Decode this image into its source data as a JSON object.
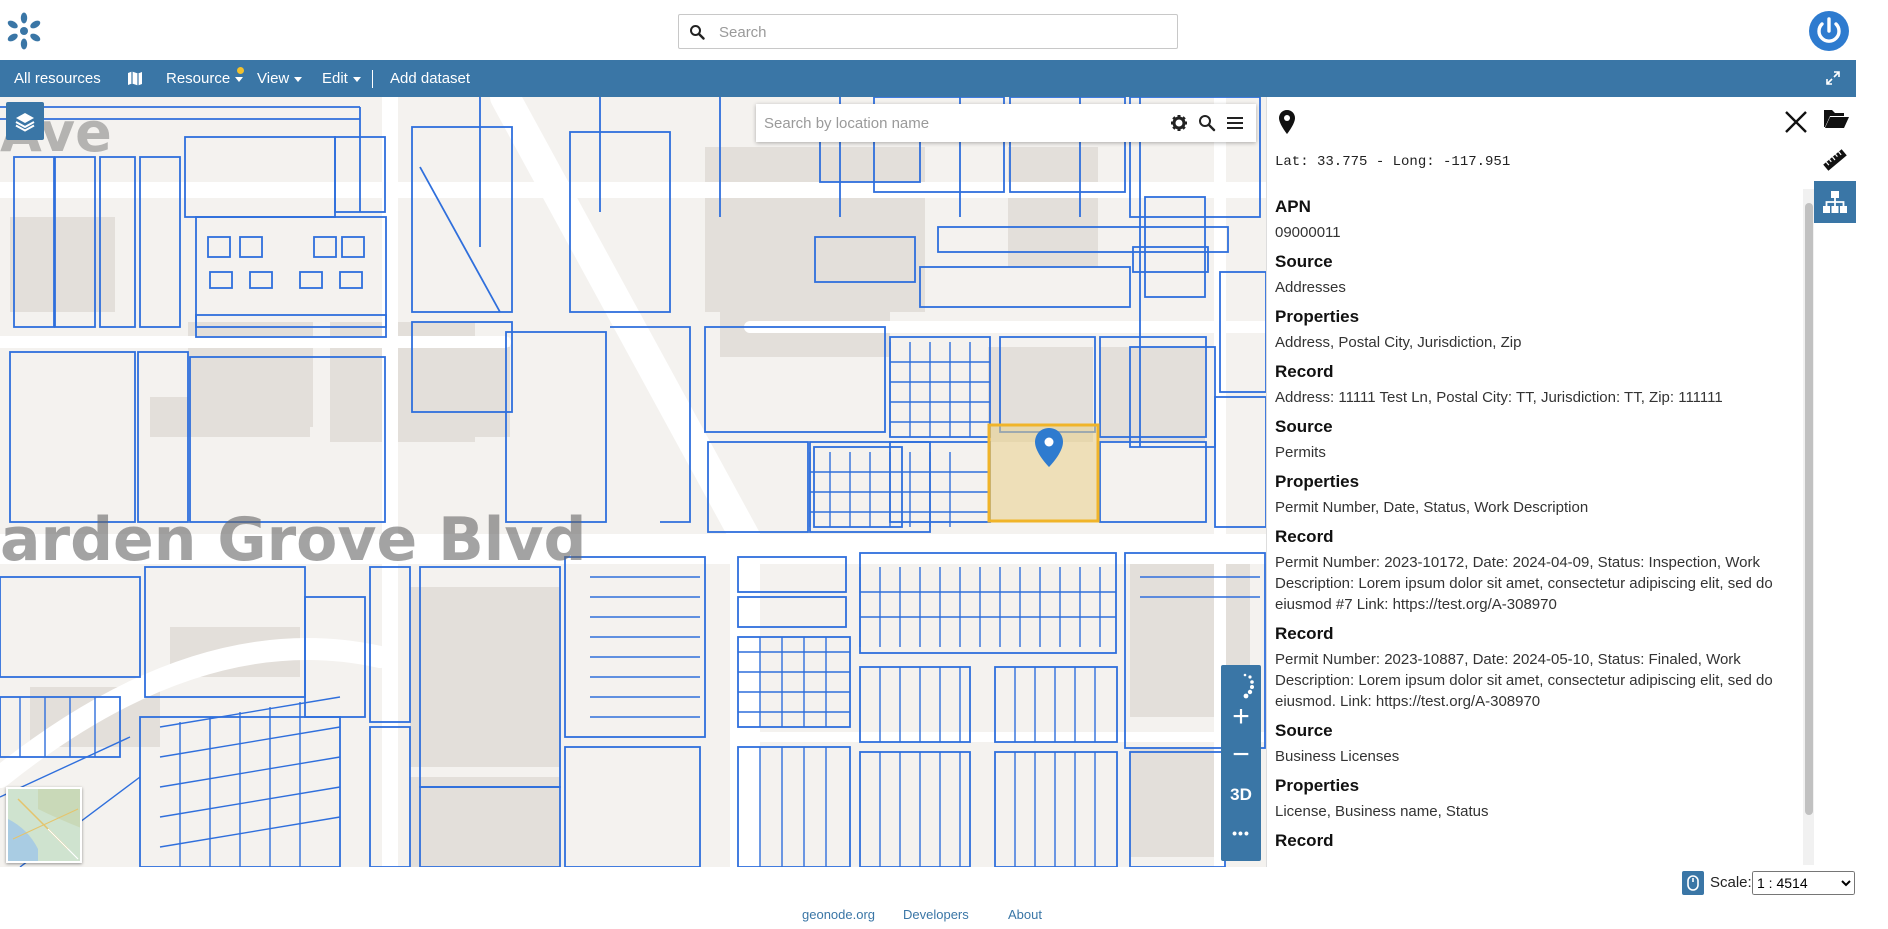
{
  "header": {
    "logo_icon": "geonode-logo-icon",
    "search_placeholder": "Search",
    "power_icon": "power-icon"
  },
  "navbar": {
    "items": [
      "All resources",
      "Resource",
      "View",
      "Edit",
      "Add dataset"
    ],
    "map_icon": "map-icon",
    "expand_icon": "expand-icon"
  },
  "map": {
    "street_labels": [
      "arden Grove Blvd",
      "Ave"
    ],
    "location_search_placeholder": "Search by location name",
    "zoom_controls": [
      "+",
      "−",
      "3D",
      "•••"
    ]
  },
  "panel": {
    "coordinates": "Lat: 33.775 - Long: -117.951",
    "feature_info": [
      {
        "kind": "heading",
        "text": "APN"
      },
      {
        "kind": "value",
        "text": "09000011"
      },
      {
        "kind": "heading",
        "text": "Source"
      },
      {
        "kind": "value",
        "text": "Addresses"
      },
      {
        "kind": "heading",
        "text": "Properties"
      },
      {
        "kind": "value",
        "text": "Address, Postal City, Jurisdiction, Zip"
      },
      {
        "kind": "heading",
        "text": "Record"
      },
      {
        "kind": "value",
        "text": "Address: 11111 Test Ln, Postal City: TT, Jurisdiction: TT, Zip: 111111"
      },
      {
        "kind": "heading",
        "text": "Source"
      },
      {
        "kind": "value",
        "text": "Permits"
      },
      {
        "kind": "heading",
        "text": "Properties"
      },
      {
        "kind": "value",
        "text": "Permit Number, Date, Status, Work Description"
      },
      {
        "kind": "heading",
        "text": "Record"
      },
      {
        "kind": "value",
        "text": "Permit Number: 2023-10172, Date: 2024-04-09, Status: Inspection, Work Description: Lorem ipsum dolor sit amet, consectetur adipiscing elit, sed do eiusmod #7 Link: https://test.org/A-308970"
      },
      {
        "kind": "heading",
        "text": "Record"
      },
      {
        "kind": "value",
        "text": "Permit Number: 2023-10887, Date: 2024-05-10, Status: Finaled, Work Description: Lorem ipsum dolor sit amet, consectetur adipiscing elit, sed do eiusmod. Link: https://test.org/A-308970"
      },
      {
        "kind": "heading",
        "text": "Source"
      },
      {
        "kind": "value",
        "text": "Business Licenses"
      },
      {
        "kind": "heading",
        "text": "Properties"
      },
      {
        "kind": "value",
        "text": "License, Business name, Status"
      },
      {
        "kind": "heading",
        "text": "Record"
      }
    ]
  },
  "right_toolbar": [
    "folder-icon",
    "ruler-icon",
    "hierarchy-icon"
  ],
  "scale": {
    "label": "Scale:",
    "value": "1 : 4514"
  },
  "footer": {
    "links": [
      "geonode.org",
      "Developers",
      "About"
    ]
  },
  "colors": {
    "primary": "#3a76a6",
    "parcel_outline": "#2f6fdc",
    "highlight": "#f0b429",
    "marker": "#2e7bcf"
  }
}
